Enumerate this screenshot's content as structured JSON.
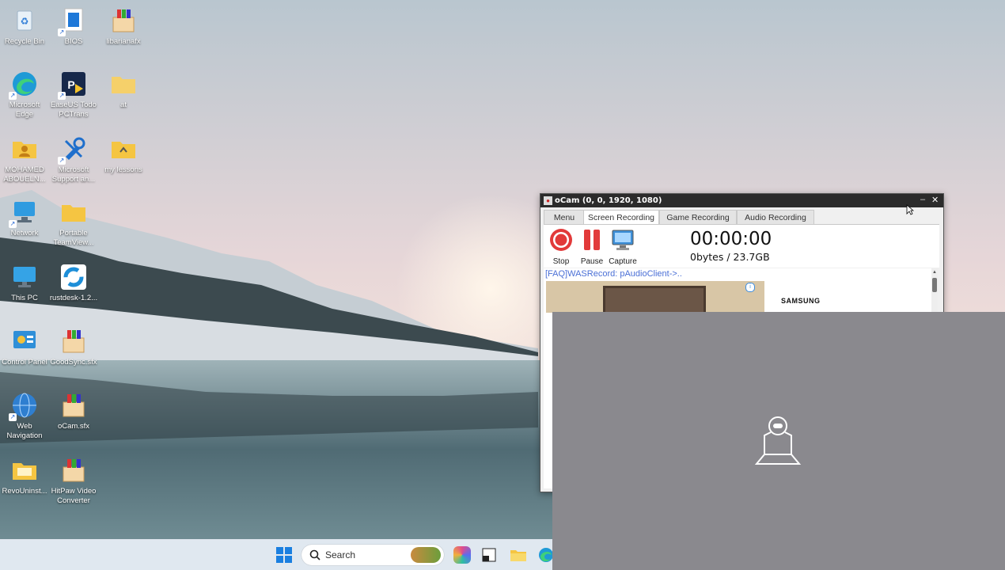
{
  "desktop_icons": [
    {
      "label": "Recycle Bin",
      "icon": "recycle-bin-icon"
    },
    {
      "label": "BIOS",
      "icon": "bios-shortcut-icon"
    },
    {
      "label": "libarianafx",
      "icon": "installer-box-icon"
    },
    {
      "label": "Microsoft Edge",
      "icon": "edge-icon"
    },
    {
      "label": "EaseUS Todo PCTrans",
      "icon": "easeus-icon"
    },
    {
      "label": "at",
      "icon": "folder-icon"
    },
    {
      "label": "MOHAMED ABOUELN...",
      "icon": "user-folder-icon"
    },
    {
      "label": "Microsoft Support an...",
      "icon": "support-tools-icon"
    },
    {
      "label": "my lessons",
      "icon": "folder-icon"
    },
    {
      "label": "Network",
      "icon": "network-icon"
    },
    {
      "label": "Portable TeamView...",
      "icon": "folder-icon"
    },
    {
      "label": "This PC",
      "icon": "monitor-icon"
    },
    {
      "label": "rustdesk-1.2...",
      "icon": "rustdesk-icon"
    },
    {
      "label": "Control Panel",
      "icon": "control-panel-icon"
    },
    {
      "label": "GoodSync.sfx",
      "icon": "installer-box-icon"
    },
    {
      "label": "Web Navigation",
      "icon": "globe-icon"
    },
    {
      "label": "oCam.sfx",
      "icon": "installer-box-icon"
    },
    {
      "label": "RevoUninst...",
      "icon": "folder-icon"
    },
    {
      "label": "HitPaw Video Converter",
      "icon": "installer-box-icon"
    }
  ],
  "taskbar": {
    "search_label": "Search",
    "apps": [
      "widgets-icon",
      "copilot-icon",
      "task-view-icon",
      "file-explorer-icon",
      "edge-icon"
    ]
  },
  "ocam": {
    "title": "oCam (0, 0, 1920, 1080)",
    "tabs": [
      "Menu",
      "Screen Recording",
      "Game Recording",
      "Audio Recording"
    ],
    "active_tab": "Screen Recording",
    "tools": [
      "Stop",
      "Pause",
      "Capture"
    ],
    "timer": "00:00:00",
    "size": "0bytes / 23.7GB",
    "faq_link": "[FAQ]WASRecord: pAudioClient->..",
    "ad_brand": "SAMSUNG"
  },
  "colors": {
    "stop_red": "#e23a3a",
    "overlay_grey": "#8a898e",
    "link_blue": "#4a6fd6"
  }
}
